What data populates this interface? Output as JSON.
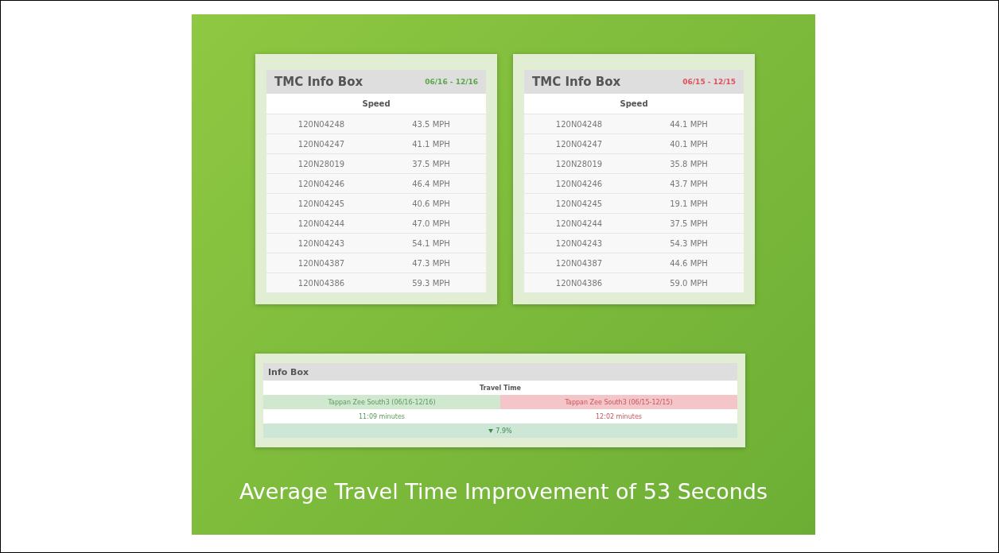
{
  "speed_boxes": [
    {
      "title": "TMC Info Box",
      "period": "06/16 - 12/16",
      "color": "#5aa64a",
      "column_heading": "Speed",
      "rows": [
        {
          "segment": "120N04248",
          "speed": "43.5 MPH"
        },
        {
          "segment": "120N04247",
          "speed": "41.1 MPH"
        },
        {
          "segment": "120N28019",
          "speed": "37.5 MPH"
        },
        {
          "segment": "120N04246",
          "speed": "46.4 MPH"
        },
        {
          "segment": "120N04245",
          "speed": "40.6 MPH"
        },
        {
          "segment": "120N04244",
          "speed": "47.0 MPH"
        },
        {
          "segment": "120N04243",
          "speed": "54.1 MPH"
        },
        {
          "segment": "120N04387",
          "speed": "47.3 MPH"
        },
        {
          "segment": "120N04386",
          "speed": "59.3 MPH"
        }
      ]
    },
    {
      "title": "TMC Info Box",
      "period": "06/15 - 12/15",
      "color": "#e0505a",
      "column_heading": "Speed",
      "rows": [
        {
          "segment": "120N04248",
          "speed": "44.1 MPH"
        },
        {
          "segment": "120N04247",
          "speed": "40.1 MPH"
        },
        {
          "segment": "120N28019",
          "speed": "35.8 MPH"
        },
        {
          "segment": "120N04246",
          "speed": "43.7 MPH"
        },
        {
          "segment": "120N04245",
          "speed": "19.1 MPH"
        },
        {
          "segment": "120N04244",
          "speed": "37.5 MPH"
        },
        {
          "segment": "120N04243",
          "speed": "54.3 MPH"
        },
        {
          "segment": "120N04387",
          "speed": "44.6 MPH"
        },
        {
          "segment": "120N04386",
          "speed": "59.0 MPH"
        }
      ]
    }
  ],
  "info_box": {
    "title": "Info Box",
    "heading": "Travel Time",
    "routes": [
      {
        "name": "Tappan Zee South3 (06/16-12/16)",
        "time": "11:09 minutes",
        "kind": "better"
      },
      {
        "name": "Tappan Zee South3 (06/15-12/15)",
        "time": "12:02 minutes",
        "kind": "worse"
      }
    ],
    "change": "7.9%"
  },
  "caption": "Average Travel Time Improvement of 53 Seconds"
}
